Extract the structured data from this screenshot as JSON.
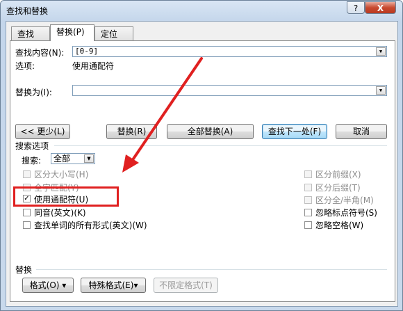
{
  "window": {
    "title": "查找和替换",
    "help": "?",
    "close": "X"
  },
  "tabs": [
    {
      "label": "查找(D)"
    },
    {
      "label": "替换(P)"
    },
    {
      "label": "定位(G)"
    }
  ],
  "find": {
    "label": "查找内容(N):",
    "value": "[0-9]",
    "options_label": "选项:",
    "options_value": "使用通配符"
  },
  "replace": {
    "label": "替换为(I):",
    "value": ""
  },
  "buttons": {
    "less": "<< 更少(L)",
    "replace": "替换(R)",
    "replace_all": "全部替换(A)",
    "find_next": "查找下一处(F)",
    "cancel": "取消"
  },
  "search_options": {
    "heading": "搜索选项",
    "search_label": "搜索:",
    "search_value": "全部",
    "left": [
      {
        "label": "区分大小写(H)",
        "checked": false,
        "disabled": true
      },
      {
        "label": "全字匹配(Y)",
        "checked": false,
        "disabled": true
      },
      {
        "label": "使用通配符(U)",
        "checked": true,
        "disabled": false
      },
      {
        "label": "同音(英文)(K)",
        "checked": false,
        "disabled": false
      },
      {
        "label": "查找单词的所有形式(英文)(W)",
        "checked": false,
        "disabled": false
      }
    ],
    "right": [
      {
        "label": "区分前缀(X)",
        "checked": false,
        "disabled": true
      },
      {
        "label": "区分后缀(T)",
        "checked": false,
        "disabled": true
      },
      {
        "label": "区分全/半角(M)",
        "checked": false,
        "disabled": true
      },
      {
        "label": "忽略标点符号(S)",
        "checked": false,
        "disabled": false
      },
      {
        "label": "忽略空格(W)",
        "checked": false,
        "disabled": false
      }
    ]
  },
  "replace_section": {
    "heading": "替换",
    "format": "格式(O) ▾",
    "special": "特殊格式(E)▾",
    "no_format": "不限定格式(T)"
  },
  "annotation_color": "#e02020"
}
